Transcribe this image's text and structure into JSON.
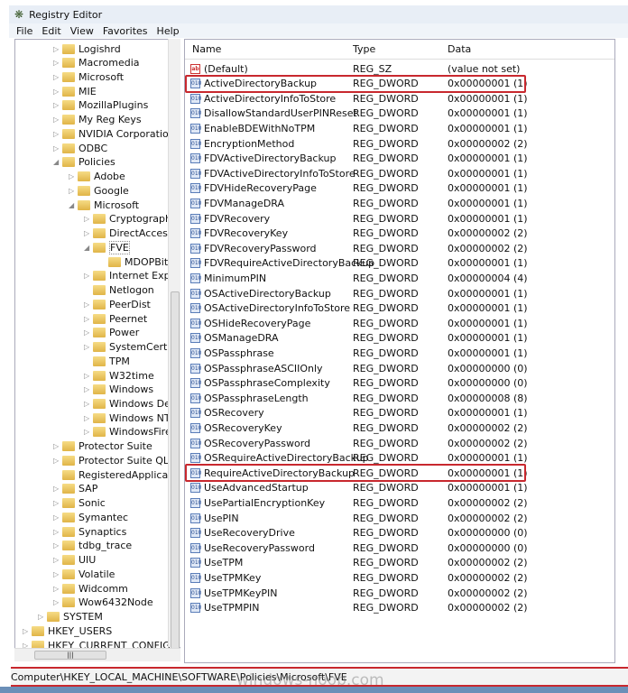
{
  "window": {
    "title": "Registry Editor",
    "icon": "regedit-icon"
  },
  "menu": [
    "File",
    "Edit",
    "View",
    "Favorites",
    "Help"
  ],
  "tree": [
    {
      "label": "Logishrd",
      "level": 2,
      "exp": "collapsed"
    },
    {
      "label": "Macromedia",
      "level": 2,
      "exp": "collapsed"
    },
    {
      "label": "Microsoft",
      "level": 2,
      "exp": "collapsed"
    },
    {
      "label": "MIE",
      "level": 2,
      "exp": "collapsed"
    },
    {
      "label": "MozillaPlugins",
      "level": 2,
      "exp": "collapsed"
    },
    {
      "label": "My Reg Keys",
      "level": 2,
      "exp": "collapsed"
    },
    {
      "label": "NVIDIA Corporation",
      "level": 2,
      "exp": "collapsed"
    },
    {
      "label": "ODBC",
      "level": 2,
      "exp": "collapsed"
    },
    {
      "label": "Policies",
      "level": 2,
      "exp": "expanded"
    },
    {
      "label": "Adobe",
      "level": 3,
      "exp": "collapsed"
    },
    {
      "label": "Google",
      "level": 3,
      "exp": "collapsed"
    },
    {
      "label": "Microsoft",
      "level": 3,
      "exp": "expanded"
    },
    {
      "label": "Cryptography",
      "level": 4,
      "exp": "collapsed"
    },
    {
      "label": "DirectAccessC",
      "level": 4,
      "exp": "collapsed"
    },
    {
      "label": "FVE",
      "level": 4,
      "exp": "expanded",
      "selected": true
    },
    {
      "label": "MDOPBitL",
      "level": 5,
      "exp": "none"
    },
    {
      "label": "Internet Explor",
      "level": 4,
      "exp": "collapsed"
    },
    {
      "label": "Netlogon",
      "level": 4,
      "exp": "none"
    },
    {
      "label": "PeerDist",
      "level": 4,
      "exp": "collapsed"
    },
    {
      "label": "Peernet",
      "level": 4,
      "exp": "collapsed"
    },
    {
      "label": "Power",
      "level": 4,
      "exp": "collapsed"
    },
    {
      "label": "SystemCertific",
      "level": 4,
      "exp": "collapsed"
    },
    {
      "label": "TPM",
      "level": 4,
      "exp": "none"
    },
    {
      "label": "W32time",
      "level": 4,
      "exp": "collapsed"
    },
    {
      "label": "Windows",
      "level": 4,
      "exp": "collapsed"
    },
    {
      "label": "Windows Defe",
      "level": 4,
      "exp": "collapsed"
    },
    {
      "label": "Windows NT",
      "level": 4,
      "exp": "collapsed"
    },
    {
      "label": "WindowsFirew",
      "level": 4,
      "exp": "collapsed"
    },
    {
      "label": "Protector Suite",
      "level": 2,
      "exp": "collapsed"
    },
    {
      "label": "Protector Suite QL",
      "level": 2,
      "exp": "collapsed"
    },
    {
      "label": "RegisteredApplication",
      "level": 2,
      "exp": "none"
    },
    {
      "label": "SAP",
      "level": 2,
      "exp": "collapsed"
    },
    {
      "label": "Sonic",
      "level": 2,
      "exp": "collapsed"
    },
    {
      "label": "Symantec",
      "level": 2,
      "exp": "collapsed"
    },
    {
      "label": "Synaptics",
      "level": 2,
      "exp": "collapsed"
    },
    {
      "label": "tdbg_trace",
      "level": 2,
      "exp": "collapsed"
    },
    {
      "label": "UIU",
      "level": 2,
      "exp": "collapsed"
    },
    {
      "label": "Volatile",
      "level": 2,
      "exp": "collapsed"
    },
    {
      "label": "Widcomm",
      "level": 2,
      "exp": "collapsed"
    },
    {
      "label": "Wow6432Node",
      "level": 2,
      "exp": "collapsed"
    },
    {
      "label": "SYSTEM",
      "level": 1,
      "exp": "collapsed"
    },
    {
      "label": "HKEY_USERS",
      "level": 0,
      "exp": "collapsed"
    },
    {
      "label": "HKEY_CURRENT_CONFIG",
      "level": 0,
      "exp": "collapsed"
    }
  ],
  "columns": {
    "name": "Name",
    "type": "Type",
    "data": "Data"
  },
  "values": [
    {
      "name": "(Default)",
      "type": "REG_SZ",
      "data": "(value not set)"
    },
    {
      "name": "ActiveDirectoryBackup",
      "type": "REG_DWORD",
      "data": "0x00000001 (1)",
      "highlight": true
    },
    {
      "name": "ActiveDirectoryInfoToStore",
      "type": "REG_DWORD",
      "data": "0x00000001 (1)"
    },
    {
      "name": "DisallowStandardUserPINReset",
      "type": "REG_DWORD",
      "data": "0x00000001 (1)"
    },
    {
      "name": "EnableBDEWithNoTPM",
      "type": "REG_DWORD",
      "data": "0x00000001 (1)"
    },
    {
      "name": "EncryptionMethod",
      "type": "REG_DWORD",
      "data": "0x00000002 (2)"
    },
    {
      "name": "FDVActiveDirectoryBackup",
      "type": "REG_DWORD",
      "data": "0x00000001 (1)"
    },
    {
      "name": "FDVActiveDirectoryInfoToStore",
      "type": "REG_DWORD",
      "data": "0x00000001 (1)"
    },
    {
      "name": "FDVHideRecoveryPage",
      "type": "REG_DWORD",
      "data": "0x00000001 (1)"
    },
    {
      "name": "FDVManageDRA",
      "type": "REG_DWORD",
      "data": "0x00000001 (1)"
    },
    {
      "name": "FDVRecovery",
      "type": "REG_DWORD",
      "data": "0x00000001 (1)"
    },
    {
      "name": "FDVRecoveryKey",
      "type": "REG_DWORD",
      "data": "0x00000002 (2)"
    },
    {
      "name": "FDVRecoveryPassword",
      "type": "REG_DWORD",
      "data": "0x00000002 (2)"
    },
    {
      "name": "FDVRequireActiveDirectoryBackup",
      "type": "REG_DWORD",
      "data": "0x00000001 (1)"
    },
    {
      "name": "MinimumPIN",
      "type": "REG_DWORD",
      "data": "0x00000004 (4)"
    },
    {
      "name": "OSActiveDirectoryBackup",
      "type": "REG_DWORD",
      "data": "0x00000001 (1)"
    },
    {
      "name": "OSActiveDirectoryInfoToStore",
      "type": "REG_DWORD",
      "data": "0x00000001 (1)"
    },
    {
      "name": "OSHideRecoveryPage",
      "type": "REG_DWORD",
      "data": "0x00000001 (1)"
    },
    {
      "name": "OSManageDRA",
      "type": "REG_DWORD",
      "data": "0x00000001 (1)"
    },
    {
      "name": "OSPassphrase",
      "type": "REG_DWORD",
      "data": "0x00000001 (1)"
    },
    {
      "name": "OSPassphraseASCIIOnly",
      "type": "REG_DWORD",
      "data": "0x00000000 (0)"
    },
    {
      "name": "OSPassphraseComplexity",
      "type": "REG_DWORD",
      "data": "0x00000000 (0)"
    },
    {
      "name": "OSPassphraseLength",
      "type": "REG_DWORD",
      "data": "0x00000008 (8)"
    },
    {
      "name": "OSRecovery",
      "type": "REG_DWORD",
      "data": "0x00000001 (1)"
    },
    {
      "name": "OSRecoveryKey",
      "type": "REG_DWORD",
      "data": "0x00000002 (2)"
    },
    {
      "name": "OSRecoveryPassword",
      "type": "REG_DWORD",
      "data": "0x00000002 (2)"
    },
    {
      "name": "OSRequireActiveDirectoryBackup",
      "type": "REG_DWORD",
      "data": "0x00000001 (1)"
    },
    {
      "name": "RequireActiveDirectoryBackup",
      "type": "REG_DWORD",
      "data": "0x00000001 (1)",
      "highlight": true
    },
    {
      "name": "UseAdvancedStartup",
      "type": "REG_DWORD",
      "data": "0x00000001 (1)"
    },
    {
      "name": "UsePartialEncryptionKey",
      "type": "REG_DWORD",
      "data": "0x00000002 (2)"
    },
    {
      "name": "UsePIN",
      "type": "REG_DWORD",
      "data": "0x00000002 (2)"
    },
    {
      "name": "UseRecoveryDrive",
      "type": "REG_DWORD",
      "data": "0x00000000 (0)"
    },
    {
      "name": "UseRecoveryPassword",
      "type": "REG_DWORD",
      "data": "0x00000000 (0)"
    },
    {
      "name": "UseTPM",
      "type": "REG_DWORD",
      "data": "0x00000002 (2)"
    },
    {
      "name": "UseTPMKey",
      "type": "REG_DWORD",
      "data": "0x00000002 (2)"
    },
    {
      "name": "UseTPMKeyPIN",
      "type": "REG_DWORD",
      "data": "0x00000002 (2)"
    },
    {
      "name": "UseTPMPIN",
      "type": "REG_DWORD",
      "data": "0x00000002 (2)"
    }
  ],
  "status_path": "Computer\\HKEY_LOCAL_MACHINE\\SOFTWARE\\Policies\\Microsoft\\FVE",
  "watermark": "windows-noob.com",
  "colors": {
    "highlight": "#c8282e",
    "folder": "#e0b447"
  }
}
